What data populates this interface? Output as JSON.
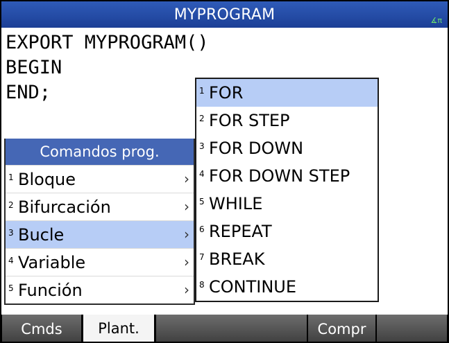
{
  "title": "MYPROGRAM",
  "angle_indicator": "∡π",
  "editor": {
    "lines": [
      "EXPORT MYPROGRAM()",
      "BEGIN",
      "END;"
    ]
  },
  "left_menu": {
    "header": "Comandos prog.",
    "items": [
      {
        "num": "1",
        "label": "Bloque",
        "chevron": "›"
      },
      {
        "num": "2",
        "label": "Bifurcación",
        "chevron": "›"
      },
      {
        "num": "3",
        "label": "Bucle",
        "chevron": "›"
      },
      {
        "num": "4",
        "label": "Variable",
        "chevron": "›"
      },
      {
        "num": "5",
        "label": "Función",
        "chevron": "›"
      }
    ]
  },
  "right_menu": {
    "items": [
      {
        "num": "1",
        "label": "FOR"
      },
      {
        "num": "2",
        "label": "FOR STEP"
      },
      {
        "num": "3",
        "label": "FOR DOWN"
      },
      {
        "num": "4",
        "label": "FOR DOWN STEP"
      },
      {
        "num": "5",
        "label": "WHILE"
      },
      {
        "num": "6",
        "label": "REPEAT"
      },
      {
        "num": "7",
        "label": "BREAK"
      },
      {
        "num": "8",
        "label": "CONTINUE"
      }
    ]
  },
  "softkeys": [
    "Cmds",
    "Plant.",
    "",
    "Compr",
    ""
  ],
  "colors": {
    "titlebar": "#2f5bb8",
    "menu_header": "#4567b5",
    "selection": "#b7cdf6"
  }
}
